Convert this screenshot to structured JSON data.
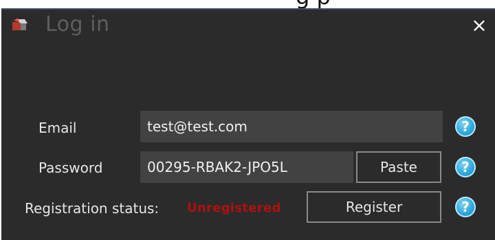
{
  "background": {
    "partial_text": "g         p"
  },
  "window": {
    "title": "Log in",
    "close_glyph": "×",
    "icon": "app-icon"
  },
  "form": {
    "email_label": "Email",
    "email_value": "test@test.com",
    "password_label": "Password",
    "password_value": "00295-RBAK2-JPO5L",
    "paste_label": "Paste",
    "registration_label": "Registration status:",
    "registration_status": "Unregistered",
    "register_label": "Register",
    "help_glyph": "?"
  },
  "colors": {
    "window_bg": "#2b2b2b",
    "field_bg": "#424242",
    "status_red": "#b01010",
    "help_blue": "#2aa7dc"
  }
}
